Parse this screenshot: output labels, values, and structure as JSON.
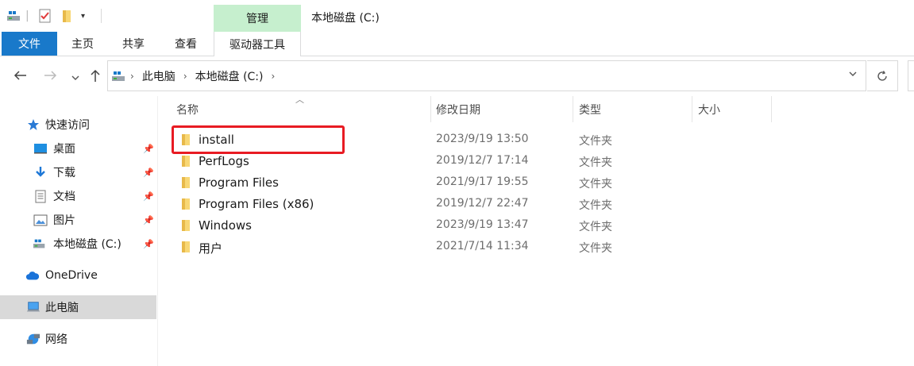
{
  "title_bar": {
    "manage_label": "管理",
    "title": "本地磁盘 (C:)"
  },
  "ribbon": {
    "tabs": [
      {
        "label": "文件"
      },
      {
        "label": "主页"
      },
      {
        "label": "共享"
      },
      {
        "label": "查看"
      },
      {
        "label": "驱动器工具"
      }
    ]
  },
  "address": {
    "crumbs": [
      "此电脑",
      "本地磁盘 (C:)"
    ]
  },
  "sidebar": {
    "quick_access": "快速访问",
    "items": [
      {
        "label": "桌面",
        "icon": "desktop-icon"
      },
      {
        "label": "下载",
        "icon": "download-icon"
      },
      {
        "label": "文档",
        "icon": "document-icon"
      },
      {
        "label": "图片",
        "icon": "picture-icon"
      },
      {
        "label": "本地磁盘 (C:)",
        "icon": "drive-icon"
      }
    ],
    "onedrive": "OneDrive",
    "this_pc": "此电脑",
    "network": "网络"
  },
  "columns": {
    "name": "名称",
    "date": "修改日期",
    "type": "类型",
    "size": "大小"
  },
  "files": [
    {
      "name": "install",
      "date": "2023/9/19 13:50",
      "type": "文件夹"
    },
    {
      "name": "PerfLogs",
      "date": "2019/12/7 17:14",
      "type": "文件夹"
    },
    {
      "name": "Program Files",
      "date": "2021/9/17 19:55",
      "type": "文件夹"
    },
    {
      "name": "Program Files (x86)",
      "date": "2019/12/7 22:47",
      "type": "文件夹"
    },
    {
      "name": "Windows",
      "date": "2023/9/19 13:47",
      "type": "文件夹"
    },
    {
      "name": "用户",
      "date": "2021/7/14 11:34",
      "type": "文件夹"
    }
  ],
  "colors": {
    "accent": "#1979ca",
    "manage_tab": "#c6efce",
    "highlight": "#e81b23",
    "folder": "#f8d775"
  }
}
